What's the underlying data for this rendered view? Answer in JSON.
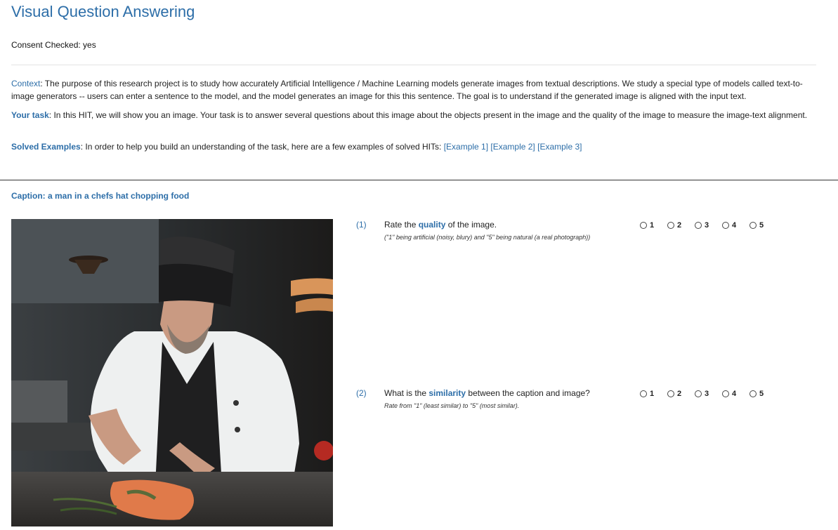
{
  "page": {
    "title": "Visual Question Answering"
  },
  "consent": {
    "text": "Consent Checked: yes"
  },
  "context": {
    "label": "Context",
    "text": ": The purpose of this research project is to study how accurately Artificial Intelligence / Machine Learning models generate images from textual descriptions. We study a special type of models called text-to-image generators -- users can enter a sentence to the model, and the model generates an image for this this sentence. The goal is to understand if the generated image is aligned with the input text."
  },
  "task": {
    "label": "Your task",
    "text": ": In this HIT, we will show you an image. Your task is to answer several questions about this image about the objects present in the image and the quality of the image to measure the image-text alignment."
  },
  "examples": {
    "label": "Solved Examples",
    "text": ": In order to help you build an understanding of the task, here are a few examples of solved HITs: ",
    "links": [
      "[Example 1]",
      "[Example 2]",
      "[Example 3]"
    ]
  },
  "caption": {
    "text": "Caption: a man in a chefs hat chopping food"
  },
  "image": {
    "description_icon": "chef-photo"
  },
  "questions": [
    {
      "number": "(1)",
      "text_before": "Rate the ",
      "keyword": "quality",
      "text_after": " of the image.",
      "hint": "(\"1\" being artificial (noisy, blury) and \"5\" being natural (a real photograph))",
      "options": [
        "1",
        "2",
        "3",
        "4",
        "5"
      ]
    },
    {
      "number": "(2)",
      "text_before": "What is the ",
      "keyword": "similarity",
      "text_after": " between the caption and image?",
      "hint": "Rate from \"1\" (least similar) to \"5\" (most similar).",
      "options": [
        "1",
        "2",
        "3",
        "4",
        "5"
      ]
    }
  ],
  "colors": {
    "accent": "#2d6ea8",
    "divider": "#333333"
  }
}
